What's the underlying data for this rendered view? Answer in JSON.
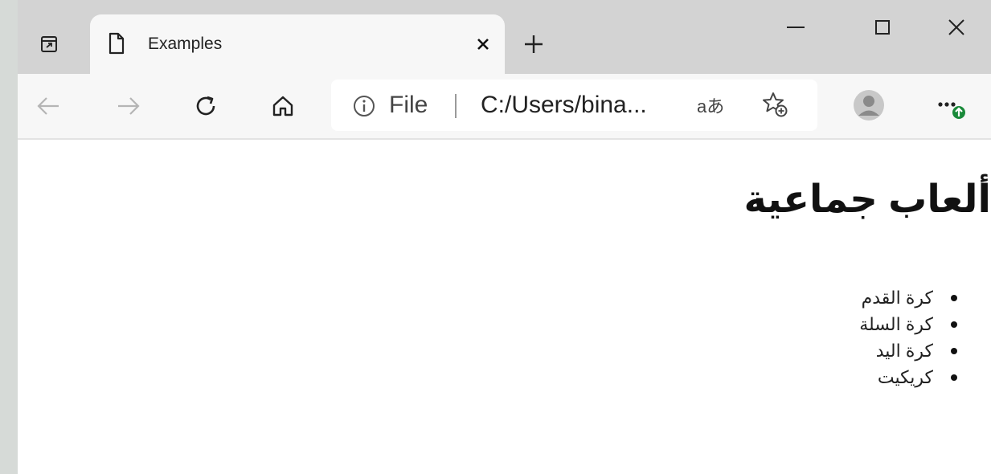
{
  "tab": {
    "title": "Examples"
  },
  "address_bar": {
    "scheme_label": "File",
    "url": "C:/Users/bina...",
    "read_aloud_label": "aあ"
  },
  "page": {
    "heading": "ألعاب جماعية",
    "items": [
      {
        "label": "كرة القدم"
      },
      {
        "label": "كرة السلة"
      },
      {
        "label": "كرة اليد"
      },
      {
        "label": "كريكيت"
      }
    ]
  },
  "icons": {
    "tab_actions": "tab-actions-icon",
    "page": "page-icon",
    "close_tab": "close-icon",
    "new_tab": "plus-icon",
    "minimize": "minimize-icon",
    "maximize": "maximize-icon",
    "close_window": "close-icon",
    "back": "back-arrow-icon",
    "forward": "forward-arrow-icon",
    "refresh": "refresh-icon",
    "home": "home-icon",
    "site_info": "info-icon",
    "favorite": "add-favorite-icon",
    "profile": "profile-icon",
    "more": "more-icon"
  },
  "colors": {
    "tabbar_bg": "#d3d3d3",
    "toolbar_bg": "#f7f7f7",
    "update_badge": "#1a8a3a"
  }
}
